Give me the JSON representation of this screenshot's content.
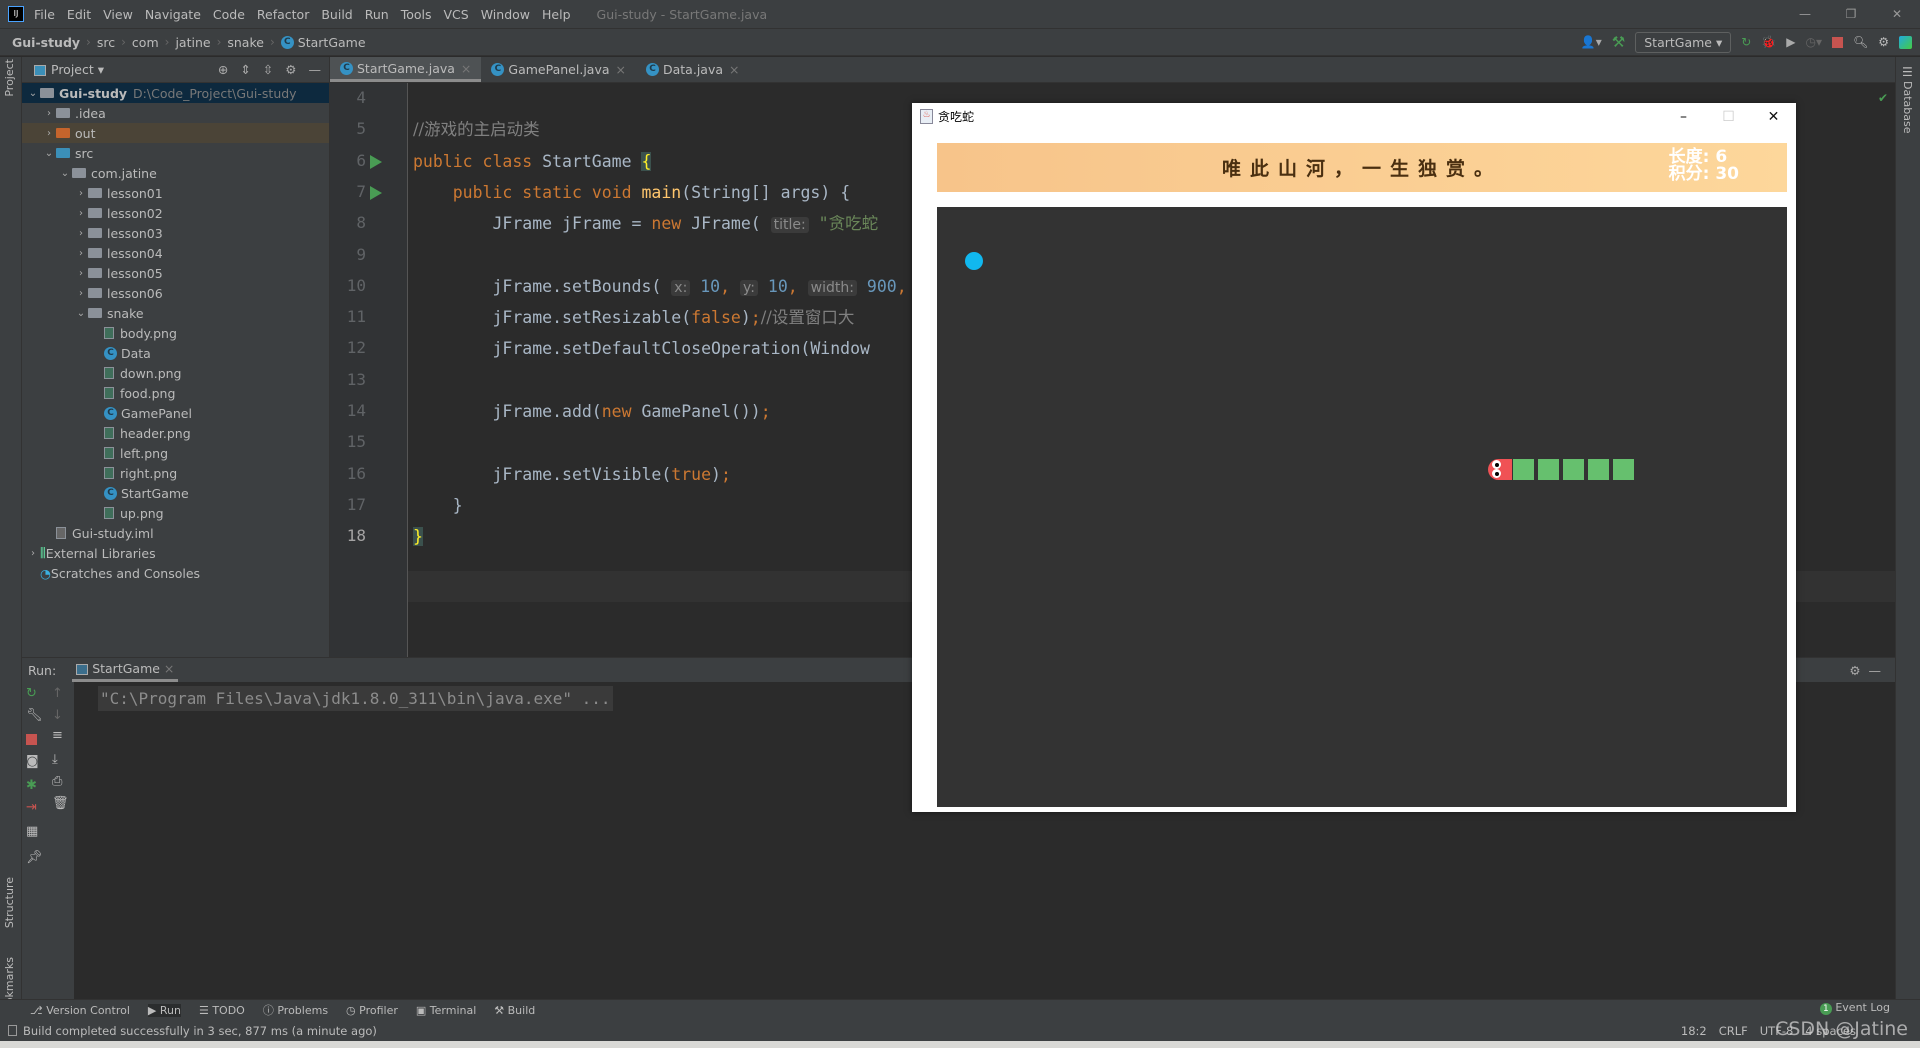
{
  "app": {
    "logo": "IJ",
    "window_title": "Gui-study - StartGame.java"
  },
  "menu": [
    "File",
    "Edit",
    "View",
    "Navigate",
    "Code",
    "Refactor",
    "Build",
    "Run",
    "Tools",
    "VCS",
    "Window",
    "Help"
  ],
  "breadcrumb": [
    "Gui-study",
    "src",
    "com",
    "jatine",
    "snake",
    "StartGame"
  ],
  "toolbar": {
    "run_config": "StartGame"
  },
  "project": {
    "title": "Project",
    "tree": [
      {
        "label": "Gui-study",
        "path": "D:\\Code_Project\\Gui-study",
        "depth": 0,
        "arrow": "open",
        "icon": "module-folder",
        "selected": true
      },
      {
        "label": ".idea",
        "depth": 1,
        "arrow": "closed",
        "icon": "folder"
      },
      {
        "label": "out",
        "depth": 1,
        "arrow": "closed",
        "icon": "out-folder",
        "highlight": true
      },
      {
        "label": "src",
        "depth": 1,
        "arrow": "open",
        "icon": "src-folder"
      },
      {
        "label": "com.jatine",
        "depth": 2,
        "arrow": "open",
        "icon": "package"
      },
      {
        "label": "lesson01",
        "depth": 3,
        "arrow": "closed",
        "icon": "package"
      },
      {
        "label": "lesson02",
        "depth": 3,
        "arrow": "closed",
        "icon": "package"
      },
      {
        "label": "lesson03",
        "depth": 3,
        "arrow": "closed",
        "icon": "package"
      },
      {
        "label": "lesson04",
        "depth": 3,
        "arrow": "closed",
        "icon": "package"
      },
      {
        "label": "lesson05",
        "depth": 3,
        "arrow": "closed",
        "icon": "package"
      },
      {
        "label": "lesson06",
        "depth": 3,
        "arrow": "closed",
        "icon": "package"
      },
      {
        "label": "snake",
        "depth": 3,
        "arrow": "open",
        "icon": "package"
      },
      {
        "label": "body.png",
        "depth": 4,
        "icon": "image"
      },
      {
        "label": "Data",
        "depth": 4,
        "icon": "class"
      },
      {
        "label": "down.png",
        "depth": 4,
        "icon": "image"
      },
      {
        "label": "food.png",
        "depth": 4,
        "icon": "image"
      },
      {
        "label": "GamePanel",
        "depth": 4,
        "icon": "class"
      },
      {
        "label": "header.png",
        "depth": 4,
        "icon": "image"
      },
      {
        "label": "left.png",
        "depth": 4,
        "icon": "image"
      },
      {
        "label": "right.png",
        "depth": 4,
        "icon": "image"
      },
      {
        "label": "StartGame",
        "depth": 4,
        "icon": "class"
      },
      {
        "label": "up.png",
        "depth": 4,
        "icon": "image"
      },
      {
        "label": "Gui-study.iml",
        "depth": 1,
        "icon": "iml"
      },
      {
        "label": "External Libraries",
        "depth": 0,
        "arrow": "closed",
        "icon": "libraries"
      },
      {
        "label": "Scratches and Consoles",
        "depth": 0,
        "icon": "scratches"
      }
    ]
  },
  "editor": {
    "tabs": [
      {
        "label": "StartGame.java",
        "active": true
      },
      {
        "label": "GamePanel.java"
      },
      {
        "label": "Data.java"
      }
    ],
    "current_line": 18,
    "lines": [
      {
        "n": 4,
        "t": []
      },
      {
        "n": 5,
        "t": [
          [
            "c",
            "//游戏的主启动类"
          ]
        ]
      },
      {
        "n": 6,
        "run": true,
        "t": [
          [
            "k",
            "public class "
          ],
          [
            "p",
            "StartGame "
          ],
          [
            "brace",
            "{"
          ]
        ]
      },
      {
        "n": 7,
        "run": true,
        "t": [
          [
            "p",
            "    "
          ],
          [
            "k",
            "public static void "
          ],
          [
            "m",
            "main"
          ],
          [
            "p",
            "(String[] args) {"
          ]
        ]
      },
      {
        "n": 8,
        "t": [
          [
            "p",
            "        JFrame jFrame = "
          ],
          [
            "k",
            "new "
          ],
          [
            "p",
            "JFrame( "
          ],
          [
            "h",
            "title:"
          ],
          [
            "s",
            " \"贪吃蛇"
          ]
        ]
      },
      {
        "n": 9,
        "t": []
      },
      {
        "n": 10,
        "t": [
          [
            "p",
            "        jFrame.setBounds( "
          ],
          [
            "h",
            "x:"
          ],
          [
            "n",
            " 10"
          ],
          [
            "k",
            ", "
          ],
          [
            "h",
            "y:"
          ],
          [
            "n",
            " 10"
          ],
          [
            "k",
            ", "
          ],
          [
            "h",
            "width:"
          ],
          [
            "n",
            " 900"
          ],
          [
            "k",
            ","
          ]
        ]
      },
      {
        "n": 11,
        "t": [
          [
            "p",
            "        jFrame.setResizable("
          ],
          [
            "k",
            "false"
          ],
          [
            "p",
            ")"
          ],
          [
            "k",
            ";"
          ],
          [
            "c",
            "//设置窗口大"
          ]
        ]
      },
      {
        "n": 12,
        "t": [
          [
            "p",
            "        jFrame.setDefaultCloseOperation(Window"
          ]
        ]
      },
      {
        "n": 13,
        "t": []
      },
      {
        "n": 14,
        "t": [
          [
            "p",
            "        jFrame.add("
          ],
          [
            "k",
            "new "
          ],
          [
            "p",
            "GamePanel())"
          ],
          [
            "k",
            ";"
          ]
        ]
      },
      {
        "n": 15,
        "t": []
      },
      {
        "n": 16,
        "t": [
          [
            "p",
            "        jFrame.setVisible("
          ],
          [
            "k",
            "true"
          ],
          [
            "p",
            ")"
          ],
          [
            "k",
            ";"
          ]
        ]
      },
      {
        "n": 17,
        "t": [
          [
            "p",
            "    }"
          ]
        ]
      },
      {
        "n": 18,
        "t": [
          [
            "brace",
            "}"
          ]
        ]
      }
    ]
  },
  "run": {
    "label": "Run:",
    "tab": "StartGame",
    "console": "\"C:\\Program Files\\Java\\jdk1.8.0_311\\bin\\java.exe\" ..."
  },
  "side_labels": {
    "project": "Project",
    "structure": "Structure",
    "bookmarks": "Bookmarks",
    "database": "Database"
  },
  "bottom_tools": [
    "Version Control",
    "Run",
    "TODO",
    "Problems",
    "Profiler",
    "Terminal",
    "Build"
  ],
  "event_log": {
    "count": "1",
    "label": "Event Log"
  },
  "status": {
    "message": "Build completed successfully in 3 sec, 877 ms (a minute ago)",
    "position": "18:2",
    "line_sep": "CRLF",
    "encoding": "UTF-8",
    "indent": "4 spaces"
  },
  "watermark": "CSDN @Jatine",
  "game": {
    "title": "贪吃蛇",
    "slogan": "唯此山河，一生独赏。",
    "length_label": "长度:",
    "length": "6",
    "score_label": "积分:",
    "score": "30",
    "snake_direction": "left",
    "colors": {
      "food": "#11b8ef",
      "snake_body": "#66c06e",
      "snake_head": "#f05255",
      "board": "#333333"
    }
  }
}
